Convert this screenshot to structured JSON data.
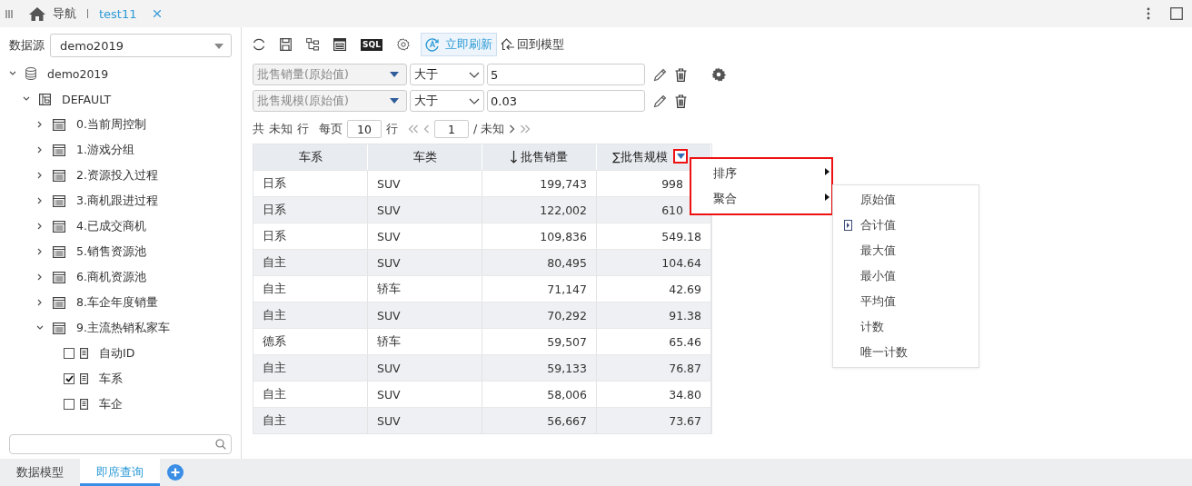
{
  "top_bar": {
    "nav_label": "导航",
    "tabs": [
      {
        "label": "test11",
        "selected": true
      }
    ]
  },
  "sidebar": {
    "datasource_label": "数据源",
    "datasource_value": "demo2019",
    "tree": [
      {
        "label": "demo2019",
        "kind": "database",
        "expanded": true,
        "children": [
          {
            "label": "DEFAULT",
            "kind": "schema",
            "expanded": true,
            "children": [
              {
                "label": "0.当前周控制",
                "kind": "table",
                "expanded": false
              },
              {
                "label": "1.游戏分组",
                "kind": "table",
                "expanded": false
              },
              {
                "label": "2.资源投入过程",
                "kind": "table",
                "expanded": false
              },
              {
                "label": "3.商机跟进过程",
                "kind": "table",
                "expanded": false
              },
              {
                "label": "4.已成交商机",
                "kind": "table",
                "expanded": false
              },
              {
                "label": "5.销售资源池",
                "kind": "table",
                "expanded": false
              },
              {
                "label": "6.商机资源池",
                "kind": "table",
                "expanded": false
              },
              {
                "label": "8.车企年度销量",
                "kind": "table",
                "expanded": false
              },
              {
                "label": "9.主流热销私家车",
                "kind": "table",
                "expanded": true,
                "children": [
                  {
                    "label": "自动ID",
                    "kind": "field",
                    "checked": false
                  },
                  {
                    "label": "车系",
                    "kind": "field",
                    "checked": true
                  },
                  {
                    "label": "车企",
                    "kind": "field",
                    "checked": false
                  }
                ]
              }
            ]
          }
        ]
      }
    ]
  },
  "toolbar": {
    "sql_badge": "SQL",
    "refresh_now": {
      "label": "立即刷新",
      "selected": true
    },
    "back_to_model": "回到模型"
  },
  "filters": [
    {
      "field": "批售销量(原始值)",
      "operator": "大于",
      "value": "5",
      "settings": true
    },
    {
      "field": "批售规模(原始值)",
      "operator": "大于",
      "value": "0.03",
      "settings": false
    }
  ],
  "pager": {
    "total_prefix": "共",
    "total": "未知",
    "total_suffix": "行",
    "per_page_label": "每页",
    "per_page": "10",
    "per_page_suffix": "行",
    "page": "1",
    "page_total": "/ 未知"
  },
  "table": {
    "columns": [
      {
        "label": "车系",
        "kind": "text",
        "sorted_descending": false,
        "menu": false
      },
      {
        "label": "车类",
        "kind": "text",
        "sorted_descending": false,
        "menu": false
      },
      {
        "label": "批售销量",
        "kind": "number",
        "sorted_descending": true,
        "menu": false
      },
      {
        "label": "∑批售规模",
        "kind": "number",
        "sorted_descending": false,
        "menu": true
      }
    ],
    "rows": [
      [
        "日系",
        "SUV",
        "199,743",
        "998"
      ],
      [
        "日系",
        "SUV",
        "122,002",
        "610"
      ],
      [
        "日系",
        "SUV",
        "109,836",
        "549.18"
      ],
      [
        "自主",
        "SUV",
        "80,495",
        "104.64"
      ],
      [
        "自主",
        "轿车",
        "71,147",
        "42.69"
      ],
      [
        "自主",
        "SUV",
        "70,292",
        "91.38"
      ],
      [
        "德系",
        "轿车",
        "59,507",
        "65.46"
      ],
      [
        "自主",
        "SUV",
        "59,133",
        "76.87"
      ],
      [
        "自主",
        "SUV",
        "58,006",
        "34.80"
      ],
      [
        "自主",
        "SUV",
        "56,667",
        "73.67"
      ]
    ]
  },
  "context_menu": {
    "items": [
      {
        "label": "排序",
        "has_submenu": true
      },
      {
        "label": "聚合",
        "has_submenu": true
      }
    ]
  },
  "submenu": {
    "items": [
      {
        "label": "原始值",
        "selected": false
      },
      {
        "label": "合计值",
        "selected": true
      },
      {
        "label": "最大值",
        "selected": false
      },
      {
        "label": "最小值",
        "selected": false
      },
      {
        "label": "平均值",
        "selected": false
      },
      {
        "label": "计数",
        "selected": false
      },
      {
        "label": "唯一计数",
        "selected": false
      }
    ]
  },
  "bottom_tabs": [
    {
      "label": "数据模型",
      "selected": false
    },
    {
      "label": "即席查询",
      "selected": true
    }
  ]
}
